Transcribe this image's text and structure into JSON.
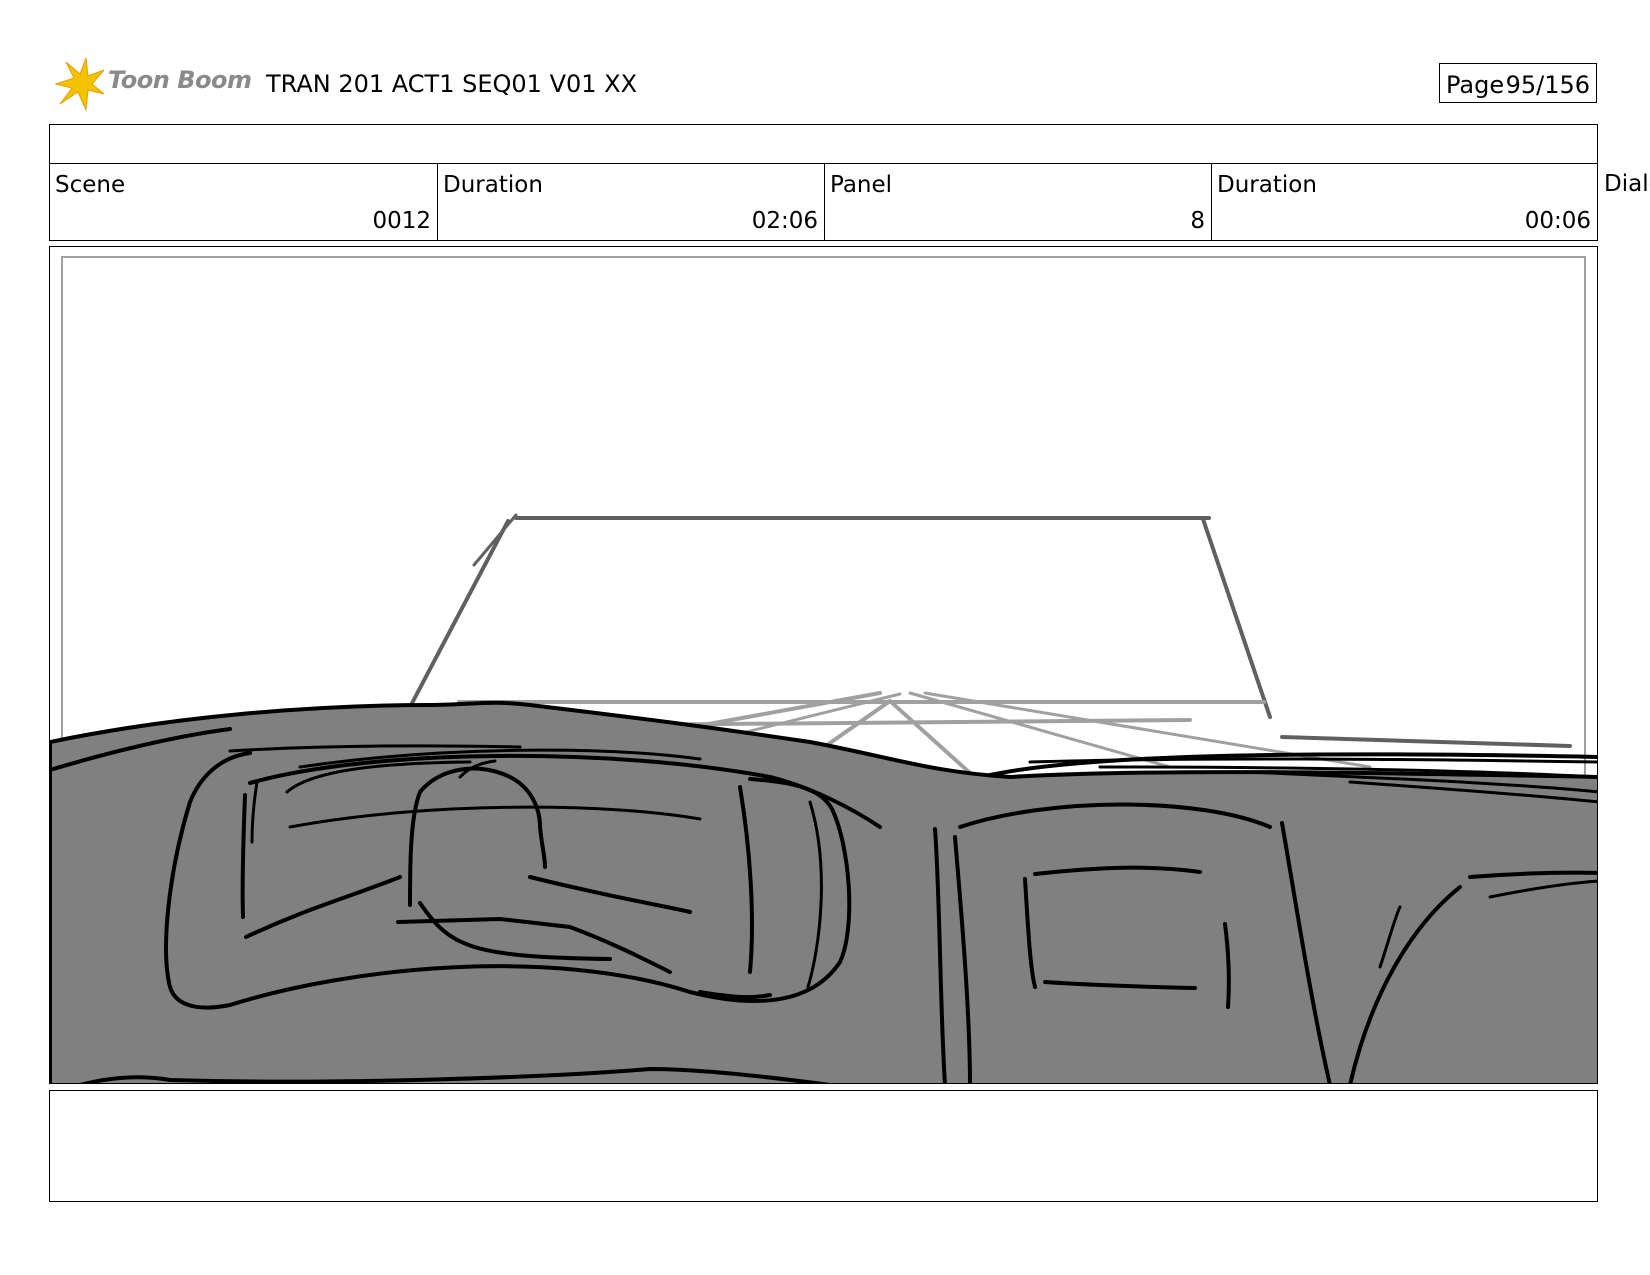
{
  "header": {
    "logo_text": "Toon Boom",
    "title": "TRAN 201 ACT1 SEQ01 V01 XX",
    "page_label": "Page",
    "page_number": "95/156"
  },
  "info": {
    "scene_label": "Scene",
    "scene_value": "0012",
    "scene_duration_label": "Duration",
    "scene_duration_value": "02:06",
    "panel_label": "Panel",
    "panel_value": "8",
    "panel_duration_label": "Duration",
    "panel_duration_value": "00:06",
    "dialog_label": "Dialo"
  },
  "colors": {
    "sketch_fill": "#808080",
    "line_dark": "#000000",
    "line_mid": "#606060",
    "line_light": "#a0a0a0",
    "logo_star": "#f5c200"
  }
}
